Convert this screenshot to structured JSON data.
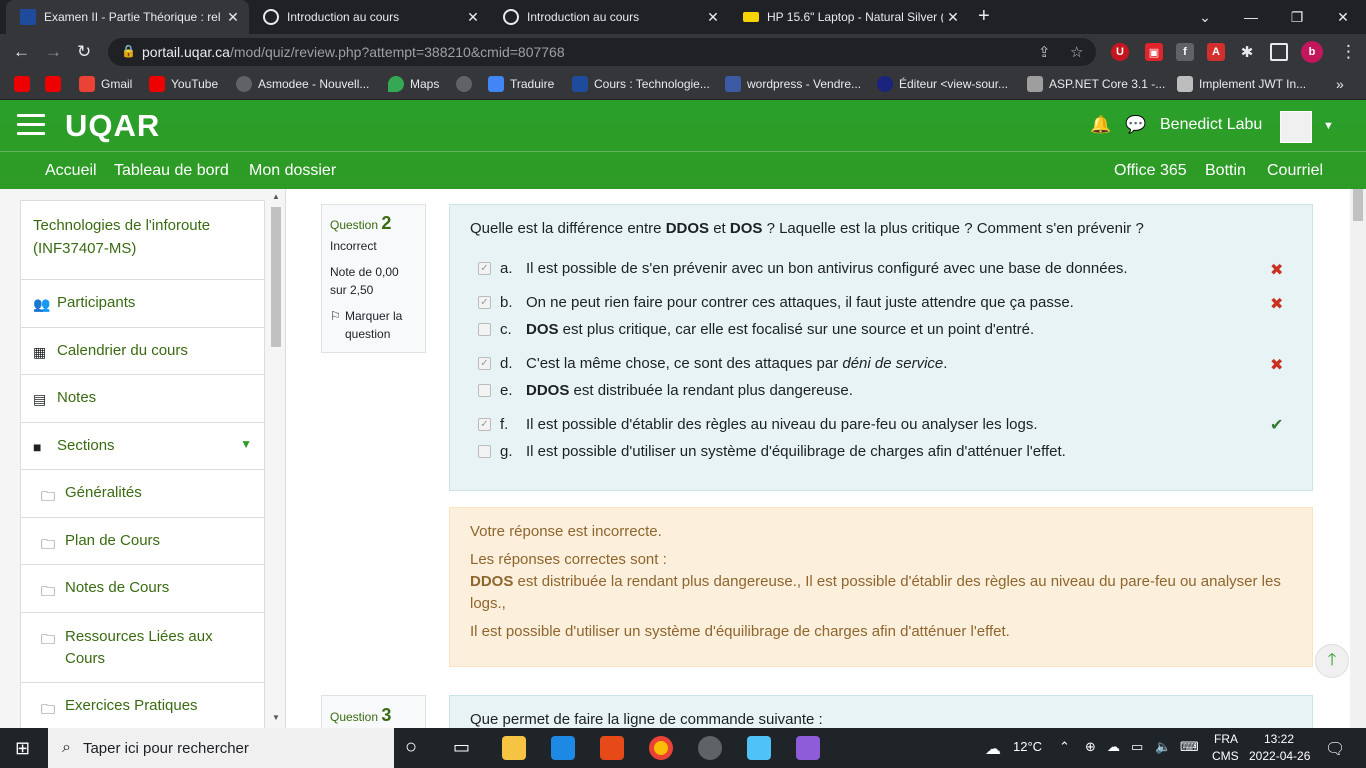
{
  "browser": {
    "tabs": [
      {
        "title": "Examen II - Partie Théorique : rel",
        "favicon_color": "#1f4b9c"
      },
      {
        "title": "Introduction au cours",
        "favicon_color": "#e8eaed"
      },
      {
        "title": "Introduction au cours",
        "favicon_color": "#e8eaed"
      },
      {
        "title": "HP 15.6\" Laptop - Natural Silver (",
        "favicon_color": "#f7d400"
      }
    ],
    "url_domain": "portail.uqar.ca",
    "url_path": "/mod/quiz/review.php?attempt=388210&cmid=807768",
    "bookmarks": [
      "",
      "",
      "Gmail",
      "YouTube",
      "Asmodee - Nouvell...",
      "Maps",
      "",
      "Traduire",
      "Cours : Technologie...",
      "wordpress - Vendre...",
      "Éditeur <view-sour...",
      "ASP.NET Core 3.1 -...",
      "Implement JWT In..."
    ],
    "profile_initial": "b"
  },
  "site": {
    "logo": "UQAR",
    "user_name": "Benedict Labu",
    "nav_left": [
      "Accueil",
      "Tableau de bord",
      "Mon dossier"
    ],
    "nav_right": [
      "Office 365",
      "Bottin",
      "Courriel"
    ]
  },
  "drawer": {
    "course_title": "Technologies de l'inforoute (INF37407-MS)",
    "items": [
      {
        "label": "Participants",
        "icon": "users-icon"
      },
      {
        "label": "Calendrier du cours",
        "icon": "calendar-icon"
      },
      {
        "label": "Notes",
        "icon": "table-icon"
      },
      {
        "label": "Sections",
        "icon": "folder-icon"
      }
    ],
    "sections": [
      "Généralités",
      "Plan de Cours",
      "Notes de Cours",
      "Ressources Liées aux Cours",
      "Exercices Pratiques"
    ]
  },
  "question2": {
    "label": "Question",
    "number": "2",
    "status": "Incorrect",
    "grade": "Note de 0,00 sur 2,50",
    "flag_label": "Marquer la question",
    "text": "Quelle est la différence entre DDOS et DOS ? Laquelle est la plus critique ? Comment s'en prévenir ?",
    "options": [
      {
        "letter": "a.",
        "text": "Il est possible de s'en prévenir avec un bon antivirus configuré avec une base de données.",
        "checked": true,
        "mark": "incorrect"
      },
      {
        "letter": "b.",
        "text": "On ne peut rien faire pour contrer ces attaques, il faut juste attendre que ça passe.",
        "checked": true,
        "mark": "incorrect"
      },
      {
        "letter": "c.",
        "text": "DOS est plus critique, car elle est focalisé sur une source et un point d'entré.",
        "checked": false,
        "mark": ""
      },
      {
        "letter": "d.",
        "text": "C'est la même chose, ce sont des attaques par déni de service.",
        "checked": true,
        "mark": "incorrect"
      },
      {
        "letter": "e.",
        "text": "DDOS est distribuée la rendant plus dangereuse.",
        "checked": false,
        "mark": ""
      },
      {
        "letter": "f.",
        "text": "Il est possible d'établir des règles au niveau du pare-feu ou analyser les logs.",
        "checked": true,
        "mark": "correct"
      },
      {
        "letter": "g.",
        "text": "Il est possible d'utiliser un système d'équilibrage de charges afin d'atténuer l'effet.",
        "checked": false,
        "mark": ""
      }
    ],
    "feedback": {
      "verdict": "Votre réponse est incorrecte.",
      "correct_intro": "Les réponses correctes sont :",
      "correct_line1": "DDOS est distribuée la rendant plus dangereuse., Il est possible d'établir des règles au niveau du pare-feu ou analyser les logs.,",
      "correct_line2": "Il est possible d'utiliser un système d'équilibrage de charges afin d'atténuer l'effet."
    }
  },
  "question3": {
    "label": "Question",
    "number": "3",
    "text": "Que permet de faire la ligne de commande suivante :"
  },
  "taskbar": {
    "search_placeholder": "Taper ici pour rechercher",
    "temperature": "12°C",
    "lang": "FRA",
    "lang_sub": "CMS",
    "time": "13:22",
    "date": "2022-04-26"
  },
  "colors": {
    "brand_green": "#2e9b26",
    "link_green": "#3a6b12",
    "incorrect_red": "#ca3120",
    "correct_green": "#357a32"
  }
}
